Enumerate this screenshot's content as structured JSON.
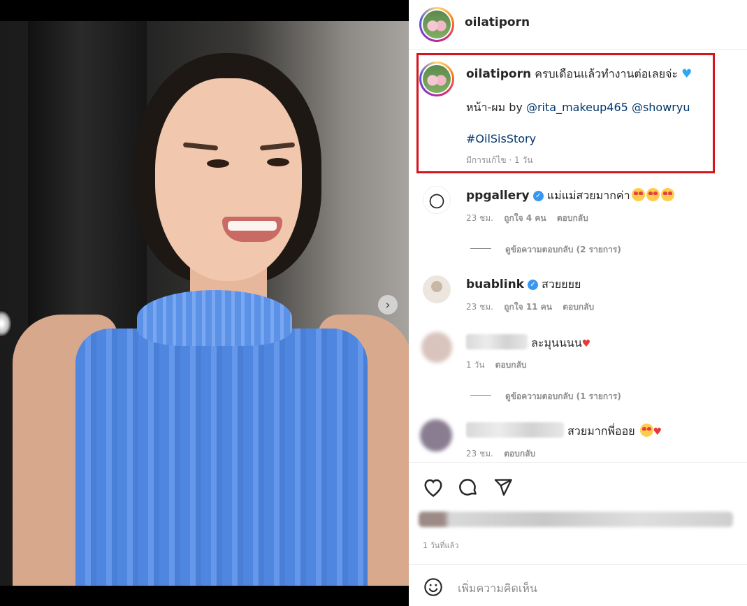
{
  "post": {
    "username": "oilatiporn",
    "caption_line1": "ครบเดือนแล้วทำงานต่อเลยจ่ะ",
    "caption_line2_prefix": "หน้า-ผม by",
    "mention1": "@rita_makeup465",
    "mention2": "@showryu",
    "hashtag": "#OilSisStory",
    "edited_meta": "มีการแก้ไข · 1 วัน"
  },
  "comments": [
    {
      "username": "ppgallery",
      "verified": true,
      "text": "แม่แม่สวยมากค่า",
      "time": "23 ชม.",
      "likes": "ถูกใจ 4 คน",
      "reply": "ตอบกลับ",
      "view_replies": "ดูข้อความตอบกลับ (2 รายการ)"
    },
    {
      "username": "buablink",
      "verified": true,
      "text": "สวยยยย",
      "time": "23 ชม.",
      "likes": "ถูกใจ 11 คน",
      "reply": "ตอบกลับ"
    },
    {
      "username": "",
      "verified": false,
      "text": "ละมุนนนน",
      "time": "1 วัน",
      "reply": "ตอบกลับ",
      "view_replies": "ดูข้อความตอบกลับ (1 รายการ)"
    },
    {
      "username": "",
      "verified": false,
      "text": "สวยมากพี่ออย",
      "time": "23 ชม.",
      "reply": "ตอบกลับ"
    }
  ],
  "footer": {
    "posted": "1 วันที่แล้ว",
    "add_comment_placeholder": "เพิ่มความคิดเห็น"
  },
  "carousel": {
    "count": 2,
    "active": 1
  },
  "colors": {
    "highlight_border": "#d6141b",
    "link": "#00376b",
    "verified": "#3897f0",
    "muted": "#8e8e8e"
  },
  "icons": [
    "heart-icon",
    "comment-icon",
    "share-icon",
    "emoji-icon",
    "chevron-right-icon",
    "verified-icon"
  ]
}
